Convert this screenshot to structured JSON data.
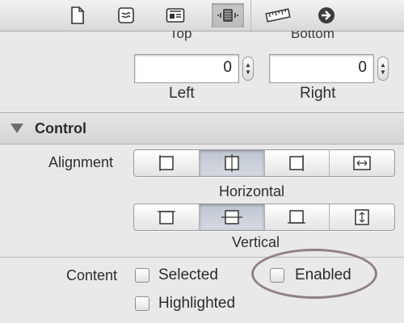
{
  "toolbar": {
    "icons": [
      {
        "name": "file-icon"
      },
      {
        "name": "quick-help-icon"
      },
      {
        "name": "identity-icon"
      },
      {
        "name": "attributes-icon",
        "selected": true
      },
      {
        "name": "size-ruler-icon"
      },
      {
        "name": "connections-arrow-icon"
      }
    ]
  },
  "spacing": {
    "top_label": "Top",
    "bottom_label": "Bottom",
    "left_value": "0",
    "right_value": "0",
    "left_label": "Left",
    "right_label": "Right"
  },
  "control_section": {
    "title": "Control",
    "alignment_label": "Alignment",
    "horizontal_caption": "Horizontal",
    "vertical_caption": "Vertical",
    "horizontal_selected": "center",
    "vertical_selected": "center",
    "content_label": "Content",
    "checkboxes": {
      "selected": "Selected",
      "enabled": "Enabled",
      "highlighted": "Highlighted"
    }
  }
}
